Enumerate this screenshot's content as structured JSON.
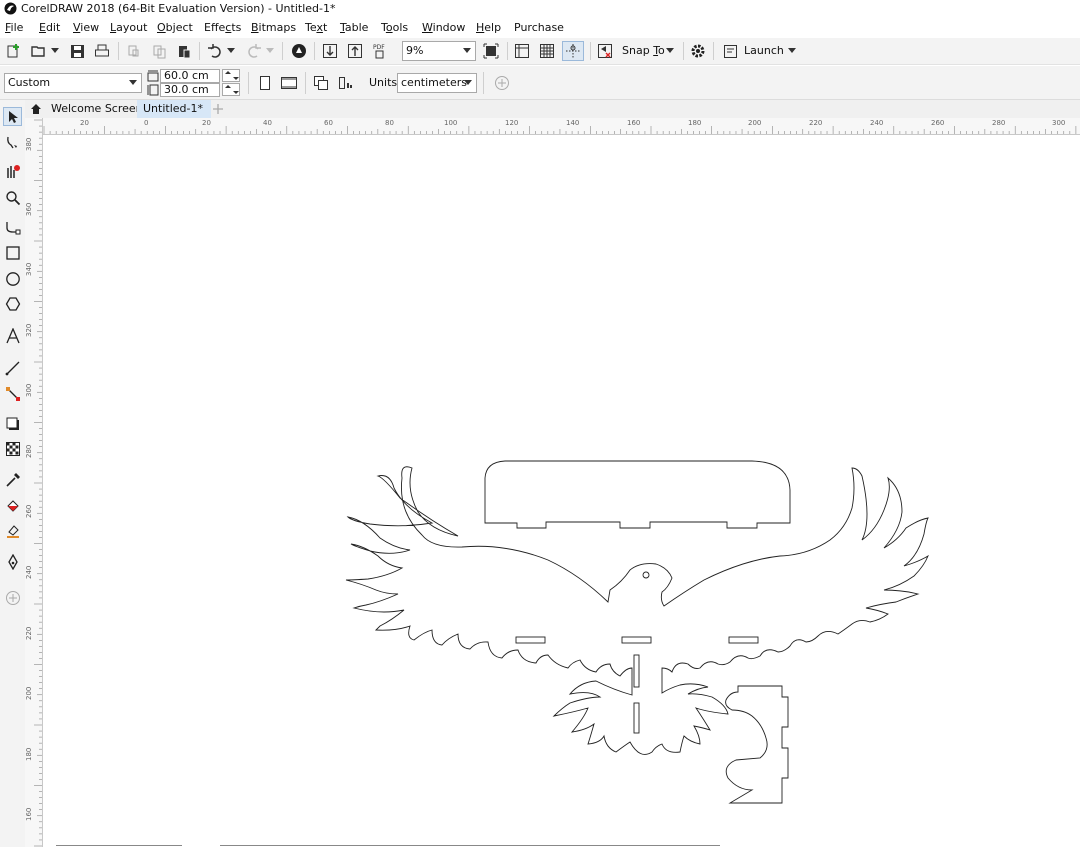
{
  "app": {
    "title": "CorelDRAW 2018 (64-Bit Evaluation Version) - Untitled-1*"
  },
  "menu": [
    {
      "pre": "",
      "u": "F",
      "post": "ile"
    },
    {
      "pre": "",
      "u": "E",
      "post": "dit"
    },
    {
      "pre": "",
      "u": "V",
      "post": "iew"
    },
    {
      "pre": "",
      "u": "L",
      "post": "ayout"
    },
    {
      "pre": "",
      "u": "O",
      "post": "bject"
    },
    {
      "pre": "Effe",
      "u": "c",
      "post": "ts"
    },
    {
      "pre": "",
      "u": "B",
      "post": "itmaps"
    },
    {
      "pre": "Te",
      "u": "x",
      "post": "t"
    },
    {
      "pre": "",
      "u": "T",
      "post": "able"
    },
    {
      "pre": "T",
      "u": "o",
      "post": "ols"
    },
    {
      "pre": "",
      "u": "W",
      "post": "indow"
    },
    {
      "pre": "",
      "u": "H",
      "post": "elp"
    },
    {
      "pre": "Purchase",
      "u": "",
      "post": ""
    }
  ],
  "standard_toolbar": {
    "zoom_value": "9%",
    "pdf_label": "PDF",
    "snap_to_pre": "Snap ",
    "snap_to_u": "T",
    "snap_to_post": "o",
    "launch_label": "Launch"
  },
  "property_bar": {
    "page_preset": "Custom",
    "width_value": "60.0 cm",
    "height_value": "30.0 cm",
    "units_label": "Units:",
    "units_value": "centimeters"
  },
  "doc_tabs": {
    "welcome_label": "Welcome Screen",
    "doc_label": "Untitled-1*"
  },
  "rulers": {
    "horizontal_labels": [
      "20",
      "0",
      "20",
      "40",
      "60",
      "80",
      "100",
      "120",
      "140",
      "160",
      "180",
      "200",
      "220",
      "240",
      "260",
      "280",
      "300"
    ],
    "vertical_labels": [
      "380",
      "360",
      "340",
      "320",
      "300",
      "280",
      "260",
      "240",
      "220",
      "200",
      "180",
      "160"
    ]
  },
  "icons": {
    "app_logo": "coreldraw-logo-icon",
    "new": "new-document-icon",
    "open": "open-folder-icon",
    "save": "save-icon",
    "print": "print-icon",
    "undo": "undo-icon",
    "redo": "redo-icon",
    "search_content": "search-content-icon",
    "import": "import-icon",
    "export": "export-icon",
    "publish_pdf": "publish-pdf-icon",
    "full_screen": "full-screen-icon",
    "show_rulers": "rulers-icon",
    "show_grid": "grid-icon",
    "show_guidelines": "guidelines-icon",
    "snap": "snap-icon",
    "options": "gear-icon",
    "launch": "launch-icon",
    "home_tab": "home-icon",
    "add_tab": "plus-icon"
  }
}
